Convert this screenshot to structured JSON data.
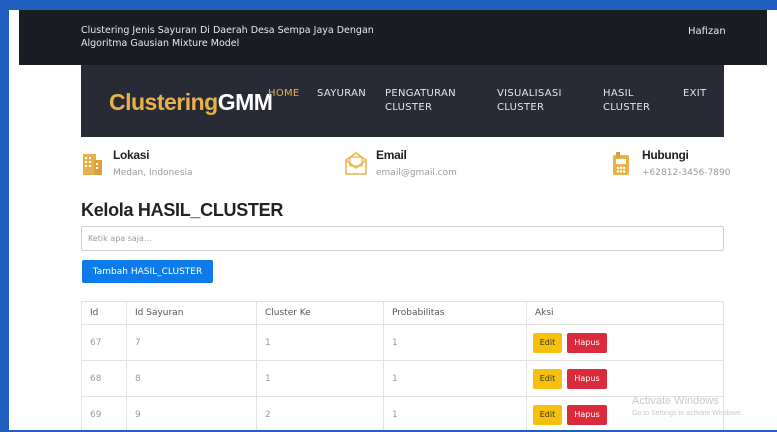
{
  "app": {
    "title": "Clustering Jenis Sayuran Di Daerah Desa Sempa Jaya Dengan Algoritma Gausian Mixture Model",
    "user": "Hafizan"
  },
  "brand": {
    "part1": "Clustering",
    "part2": "GMM",
    "accent": "#e8b24a"
  },
  "nav": {
    "items": [
      {
        "label": "HOME",
        "active": true
      },
      {
        "label": "SAYURAN"
      },
      {
        "label": "PENGATURAN CLUSTER"
      },
      {
        "label": "VISUALISASI CLUSTER"
      },
      {
        "label": "HASIL CLUSTER"
      },
      {
        "label": "EXIT"
      }
    ]
  },
  "info": {
    "lokasi": {
      "title": "Lokasi",
      "value": "Medan, Indonesia",
      "icon": "building-icon"
    },
    "email": {
      "title": "Email",
      "value": "email@gmail.com",
      "icon": "envelope-icon"
    },
    "hubungi": {
      "title": "Hubungi",
      "value": "+62812-3456-7890",
      "icon": "phone-icon"
    }
  },
  "main": {
    "heading": "Kelola HASIL_CLUSTER",
    "search_placeholder": "Ketik apa saja...",
    "add_button": "Tambah HASIL_CLUSTER"
  },
  "table": {
    "headers": [
      "Id",
      "Id Sayuran",
      "Cluster Ke",
      "Probabilitas",
      "Aksi"
    ],
    "rows": [
      {
        "id": "67",
        "id_sayuran": "7",
        "cluster_ke": "1",
        "probabilitas": "1"
      },
      {
        "id": "68",
        "id_sayuran": "8",
        "cluster_ke": "1",
        "probabilitas": "1"
      },
      {
        "id": "69",
        "id_sayuran": "9",
        "cluster_ke": "2",
        "probabilitas": "1"
      }
    ],
    "edit_label": "Edit",
    "delete_label": "Hapus"
  },
  "watermark": {
    "line1": "Activate Windows",
    "line2": "Go to Settings to activate Windows."
  },
  "colors": {
    "topbar": "#1b1d24",
    "navbar": "#282b35",
    "primary": "#0d7bea",
    "warning": "#f5c10d",
    "danger": "#dc2a3d"
  }
}
